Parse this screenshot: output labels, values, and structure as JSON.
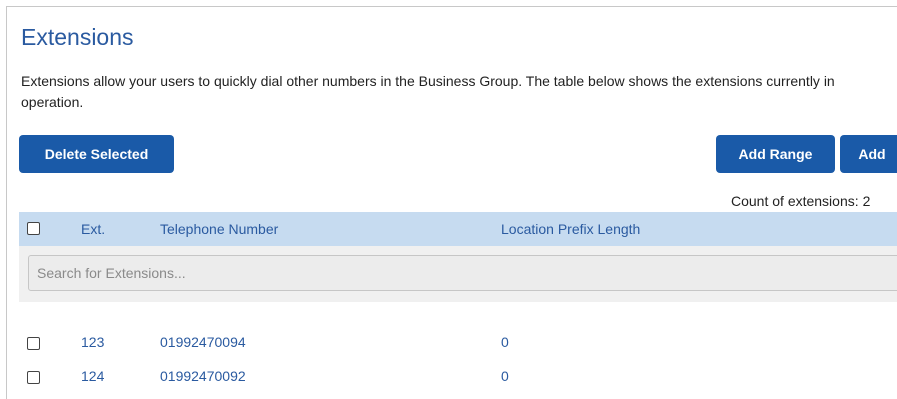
{
  "page": {
    "title": "Extensions",
    "intro": "Extensions allow your users to quickly dial other numbers in the Business Group. The table below shows the extensions currently in operation."
  },
  "toolbar": {
    "delete_label": "Delete Selected",
    "add_range_label": "Add Range",
    "add_label": "Add"
  },
  "count": {
    "label": "Count of extensions:",
    "value": "2"
  },
  "table": {
    "columns": [
      "Ext.",
      "Telephone Number",
      "Location Prefix Length"
    ],
    "search_placeholder": "Search for Extensions...",
    "rows": [
      {
        "ext": "123",
        "telephone": "01992470094",
        "prefix_length": "0"
      },
      {
        "ext": "124",
        "telephone": "01992470092",
        "prefix_length": "0"
      }
    ]
  },
  "colors": {
    "accent": "#1a5aa8",
    "title": "#2a5aa0",
    "header_bg": "#c6dbf0"
  }
}
